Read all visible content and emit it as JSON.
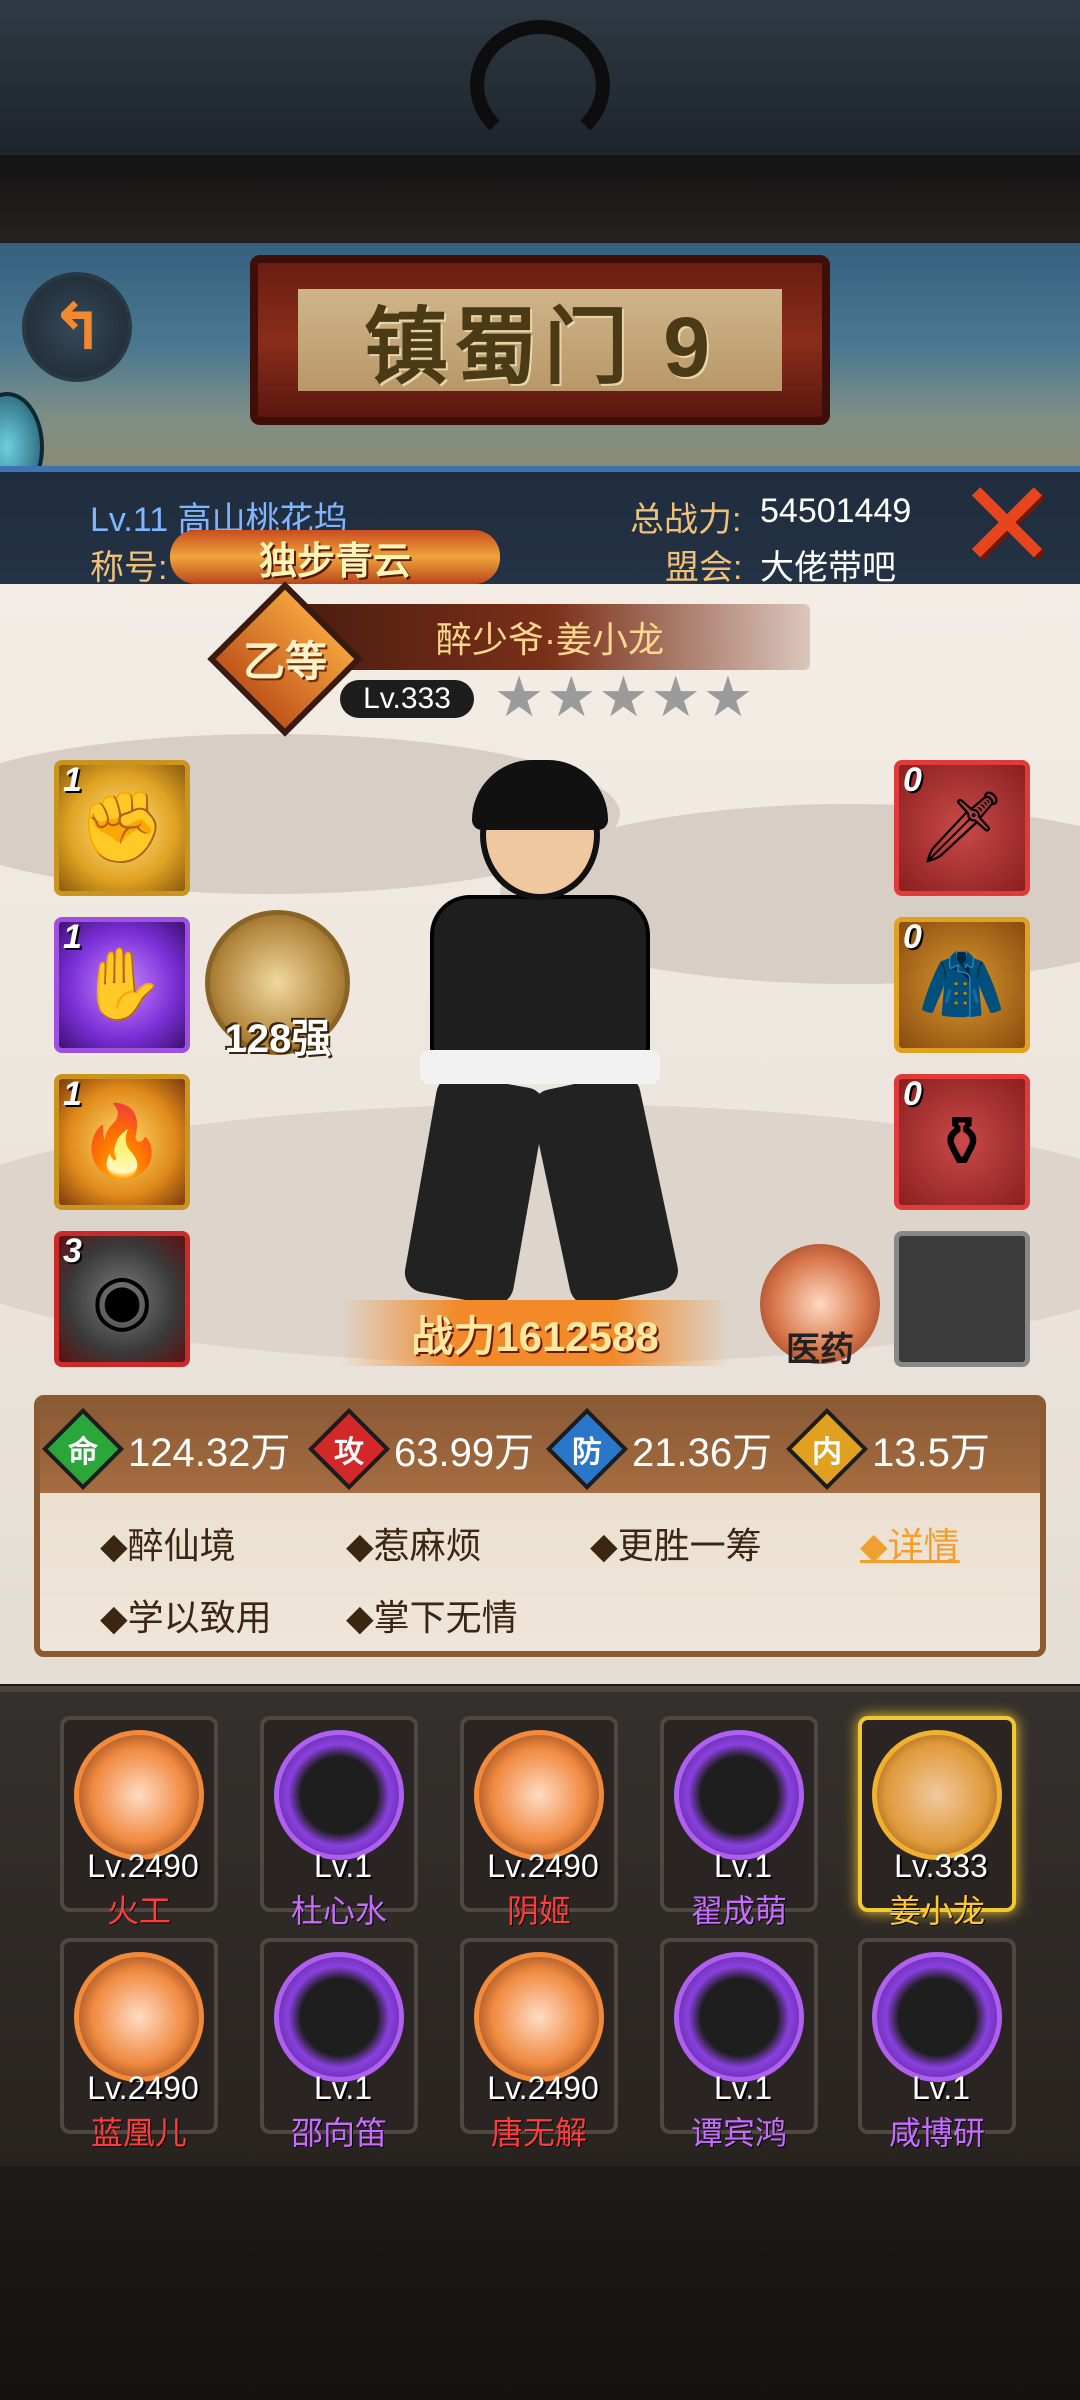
{
  "scene": {
    "sign_title": "镇蜀门 9",
    "back_icon": "back-arrow-icon"
  },
  "header": {
    "level_location": "Lv.11 高山桃花坞",
    "title_label": "称号:",
    "title_badge": "独步青云",
    "power_label": "总战力:",
    "power_value": "54501449",
    "guild_label": "盟会:",
    "guild_value": "大佬带吧"
  },
  "hero": {
    "rank": "乙等",
    "name": "醉少爷·姜小龙",
    "level": "Lv.333",
    "stars_total": 5,
    "stars_lit": 0,
    "enhance_label": "128强",
    "power_banner": "战力1612588",
    "medicine_label": "医药"
  },
  "skills": [
    {
      "count": "1",
      "icon": "fist-icon"
    },
    {
      "count": "1",
      "icon": "purple-palm-icon"
    },
    {
      "count": "1",
      "icon": "flame-fist-icon"
    },
    {
      "count": "3",
      "icon": "stone-disc-icon"
    }
  ],
  "equipment": [
    {
      "count": "0",
      "icon": "weapon-icon"
    },
    {
      "count": "0",
      "icon": "armor-icon"
    },
    {
      "count": "0",
      "icon": "amulet-icon"
    },
    {
      "count": "",
      "icon": "empty-slot-icon"
    }
  ],
  "stats": [
    {
      "badge": "命",
      "value": "124.32万"
    },
    {
      "badge": "攻",
      "value": "63.99万"
    },
    {
      "badge": "防",
      "value": "21.36万"
    },
    {
      "badge": "内",
      "value": "13.5万"
    }
  ],
  "traits": [
    "◆醉仙境",
    "◆惹麻烦",
    "◆更胜一筹",
    "◆学以致用",
    "◆掌下无情"
  ],
  "detail_link": "◆详情",
  "roster": [
    {
      "level": "Lv.2490",
      "name": "火工",
      "frame": "orange",
      "color": "red"
    },
    {
      "level": "Lv.1",
      "name": "杜心水",
      "frame": "purple",
      "color": "purple"
    },
    {
      "level": "Lv.2490",
      "name": "阴姬",
      "frame": "orange",
      "color": "red"
    },
    {
      "level": "Lv.1",
      "name": "翟成萌",
      "frame": "purple",
      "color": "purple"
    },
    {
      "level": "Lv.333",
      "name": "姜小龙",
      "frame": "gold",
      "color": "gold",
      "selected": true
    },
    {
      "level": "Lv.2490",
      "name": "蓝凰儿",
      "frame": "orange",
      "color": "red"
    },
    {
      "level": "Lv.1",
      "name": "邵向笛",
      "frame": "purple",
      "color": "purple"
    },
    {
      "level": "Lv.2490",
      "name": "唐无解",
      "frame": "orange",
      "color": "red"
    },
    {
      "level": "Lv.1",
      "name": "谭宾鸿",
      "frame": "purple",
      "color": "purple"
    },
    {
      "level": "Lv.1",
      "name": "咸博研",
      "frame": "purple",
      "color": "purple"
    }
  ]
}
